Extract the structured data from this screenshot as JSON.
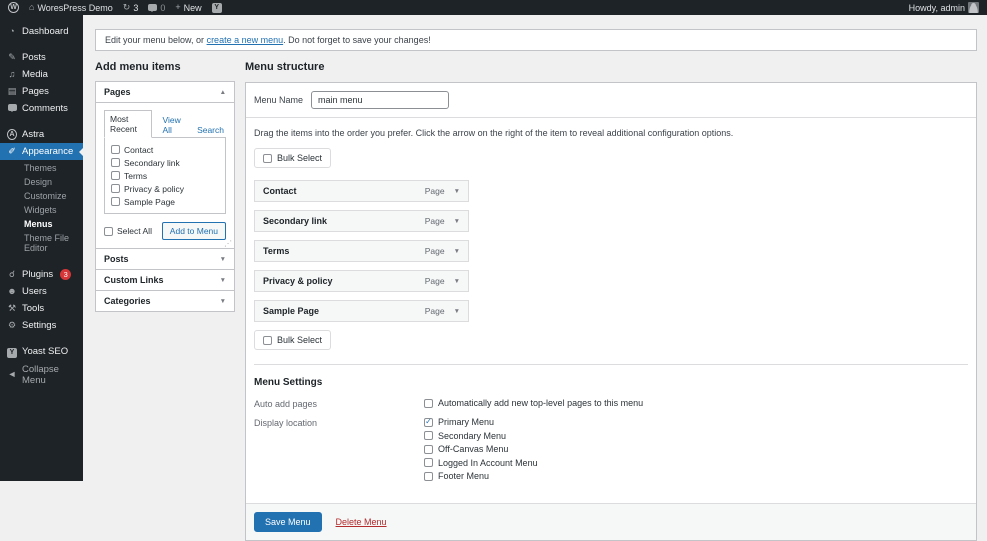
{
  "icons": {
    "wp": "W",
    "home": "⌂",
    "updates": "↻",
    "plus": "+",
    "dashboard": "◔",
    "posts": "✎",
    "media": "♫",
    "pages": "▤",
    "astra": "A",
    "appearance": "✐",
    "plugins": "☌",
    "users": "☻",
    "tools": "⚒",
    "settings": "⚙",
    "yoast": "Y",
    "collapse": "◄",
    "caret_up": "▲",
    "caret_down": "▼"
  },
  "admin_bar": {
    "site_name": "WoresPress Demo",
    "updates_count": "3",
    "comments_count": "0",
    "new_label": "New",
    "howdy_text": "Howdy, admin"
  },
  "sidebar": {
    "items": [
      {
        "label": "Dashboard"
      },
      {
        "label": "Posts"
      },
      {
        "label": "Media"
      },
      {
        "label": "Pages"
      },
      {
        "label": "Comments"
      },
      {
        "label": "Astra"
      },
      {
        "label": "Appearance"
      },
      {
        "label": "Plugins",
        "badge": "3"
      },
      {
        "label": "Users"
      },
      {
        "label": "Tools"
      },
      {
        "label": "Settings"
      },
      {
        "label": "Yoast SEO"
      },
      {
        "label": "Collapse Menu"
      }
    ],
    "appearance_submenu": [
      {
        "label": "Themes",
        "current": false
      },
      {
        "label": "Design",
        "current": false
      },
      {
        "label": "Customize",
        "current": false
      },
      {
        "label": "Widgets",
        "current": false
      },
      {
        "label": "Menus",
        "current": true
      },
      {
        "label": "Theme File Editor",
        "current": false
      }
    ]
  },
  "notice": {
    "text_before_link": "Edit your menu below, or ",
    "link_text": "create a new menu",
    "text_after_link": ". Do not forget to save your changes!"
  },
  "add_menu_items": {
    "title": "Add menu items",
    "pages_accordion": {
      "label": "Pages",
      "tabs": [
        {
          "label": "Most Recent",
          "active": true
        },
        {
          "label": "View All",
          "active": false
        },
        {
          "label": "Search",
          "active": false
        }
      ],
      "page_checkboxes": [
        {
          "label": "Contact",
          "checked": false
        },
        {
          "label": "Secondary link",
          "checked": false
        },
        {
          "label": "Terms",
          "checked": false
        },
        {
          "label": "Privacy & policy",
          "checked": false
        },
        {
          "label": "Sample Page",
          "checked": false
        }
      ],
      "select_all_label": "Select All",
      "add_to_menu_button": "Add to Menu"
    },
    "collapsed_accordions": [
      {
        "label": "Posts"
      },
      {
        "label": "Custom Links"
      },
      {
        "label": "Categories"
      }
    ]
  },
  "menu_structure": {
    "title": "Menu structure",
    "menu_name_label": "Menu Name",
    "menu_name_value": "main menu",
    "instructions": "Drag the items into the order you prefer. Click the arrow on the right of the item to reveal additional configuration options.",
    "bulk_select_label": "Bulk Select",
    "items": [
      {
        "title": "Contact",
        "type": "Page"
      },
      {
        "title": "Secondary link",
        "type": "Page"
      },
      {
        "title": "Terms",
        "type": "Page"
      },
      {
        "title": "Privacy & policy",
        "type": "Page"
      },
      {
        "title": "Sample Page",
        "type": "Page"
      }
    ],
    "settings": {
      "title": "Menu Settings",
      "auto_add_pages_label": "Auto add pages",
      "auto_add_pages_option": "Automatically add new top-level pages to this menu",
      "auto_add_pages_checked": false,
      "display_location_label": "Display location",
      "locations": [
        {
          "label": "Primary Menu",
          "checked": true
        },
        {
          "label": "Secondary Menu",
          "checked": false
        },
        {
          "label": "Off-Canvas Menu",
          "checked": false
        },
        {
          "label": "Logged In Account Menu",
          "checked": false
        },
        {
          "label": "Footer Menu",
          "checked": false
        }
      ]
    },
    "save_button": "Save Menu",
    "delete_link": "Delete Menu"
  },
  "colors": {
    "admin_dark": "#1d2327",
    "accent_blue": "#2271b1",
    "badge_red": "#d63638",
    "delete_red": "#b32d2e",
    "content_bg": "#f0f0f1"
  }
}
